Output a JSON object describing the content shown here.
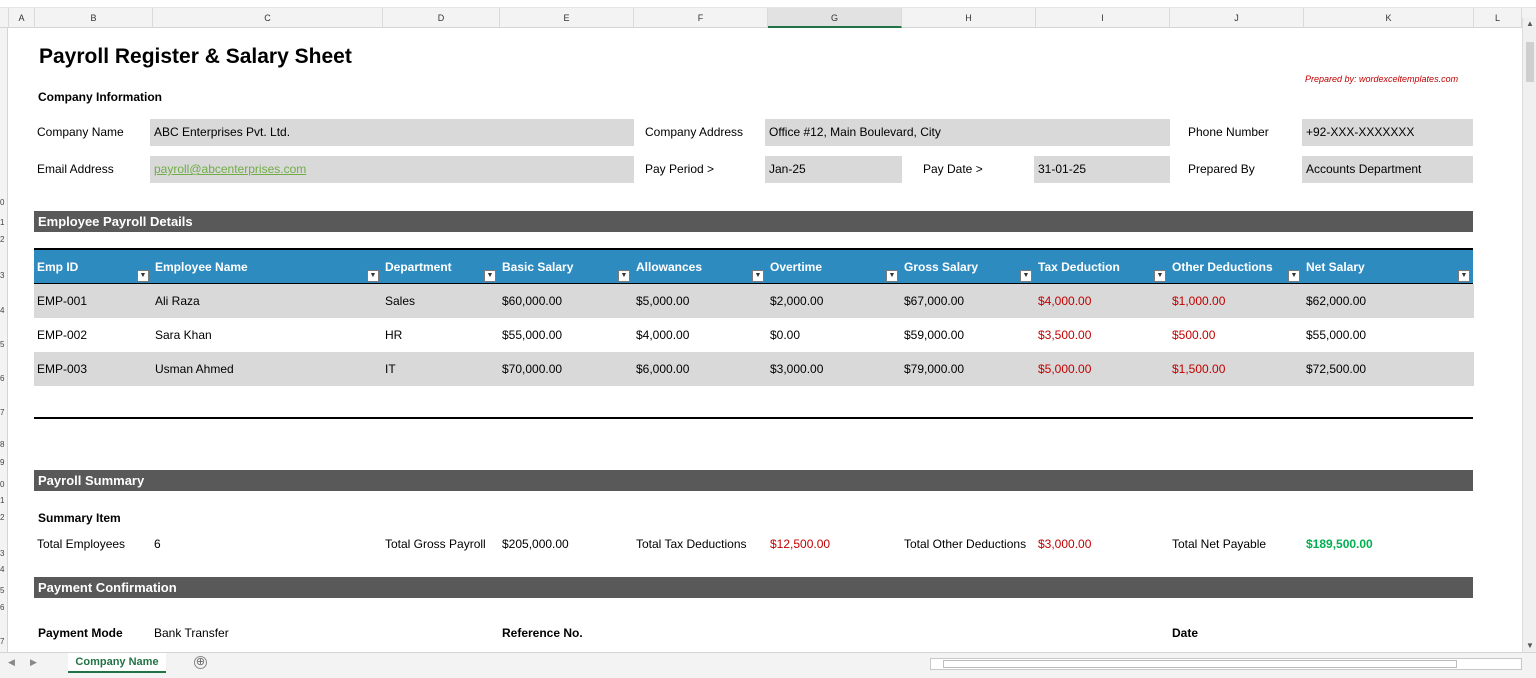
{
  "excel": {
    "columns": [
      "A",
      "B",
      "C",
      "D",
      "E",
      "F",
      "G",
      "H",
      "I",
      "J",
      "K",
      "L"
    ],
    "selected_column": "G",
    "rows": [
      "0",
      "1",
      "2",
      "3",
      "4",
      "5",
      "6",
      "7",
      "8",
      "9",
      "0",
      "1",
      "2",
      "3",
      "4",
      "5",
      "6",
      "7"
    ],
    "sheet_tab": "Company Name",
    "add_sheet_icon": "⊕"
  },
  "header": {
    "title": "Payroll Register & Salary Sheet",
    "prepared_by_note": "Prepared by: wordexceltemplates.com"
  },
  "company": {
    "section_label": "Company Information",
    "name_label": "Company Name",
    "name_value": "ABC Enterprises Pvt. Ltd.",
    "address_label": "Company Address",
    "address_value": "Office #12, Main Boulevard, City",
    "phone_label": "Phone Number",
    "phone_value": "+92-XXX-XXXXXXX",
    "email_label": "Email Address",
    "email_value": "payroll@abcenterprises.com",
    "pay_period_label": "Pay Period >",
    "pay_period_value": "Jan-25",
    "pay_date_label": "Pay Date >",
    "pay_date_value": "31-01-25",
    "prepared_by_label": "Prepared By",
    "prepared_by_value": "Accounts Department"
  },
  "payroll": {
    "section_label": "Employee Payroll Details",
    "header_color": "#2e8bc0",
    "columns": [
      "Emp ID",
      "Employee Name",
      "Department",
      "Basic Salary",
      "Allowances",
      "Overtime",
      "Gross Salary",
      "Tax Deduction",
      "Other Deductions",
      "Net Salary"
    ],
    "rows": [
      [
        "EMP-001",
        "Ali Raza",
        "Sales",
        "$60,000.00",
        "$5,000.00",
        "$2,000.00",
        "$67,000.00",
        "$4,000.00",
        "$1,000.00",
        "$62,000.00"
      ],
      [
        "EMP-002",
        "Sara Khan",
        "HR",
        "$55,000.00",
        "$4,000.00",
        "$0.00",
        "$59,000.00",
        "$3,500.00",
        "$500.00",
        "$55,000.00"
      ],
      [
        "EMP-003",
        "Usman Ahmed",
        "IT",
        "$70,000.00",
        "$6,000.00",
        "$3,000.00",
        "$79,000.00",
        "$5,000.00",
        "$1,500.00",
        "$72,500.00"
      ]
    ]
  },
  "summary": {
    "section_label": "Payroll Summary",
    "item_label": "Summary Item",
    "total_employees_label": "Total Employees",
    "total_employees_value": "6",
    "total_gross_label": "Total Gross Payroll",
    "total_gross_value": "$205,000.00",
    "total_tax_label": "Total Tax Deductions",
    "total_tax_value": "$12,500.00",
    "total_other_label": "Total Other Deductions",
    "total_other_value": "$3,000.00",
    "total_net_label": "Total Net Payable",
    "total_net_value": "$189,500.00"
  },
  "payment": {
    "section_label": "Payment Confirmation",
    "mode_label": "Payment Mode",
    "mode_value": "Bank Transfer",
    "reference_label": "Reference No.",
    "date_label": "Date"
  },
  "colors": {
    "band": "#595959",
    "field": "#d9d9d9",
    "deduction": "#c00000",
    "net_payable": "#00b050",
    "link": "#70ad47"
  }
}
